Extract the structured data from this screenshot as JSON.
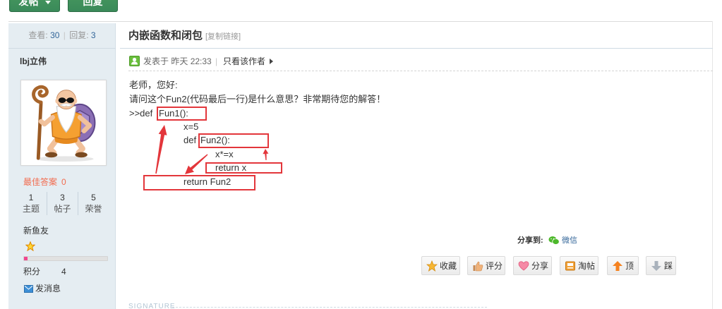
{
  "toolbar": {
    "post_label": "发帖",
    "reply_label": "回复"
  },
  "sidebar": {
    "views_label": "查看:",
    "views": "30",
    "separator": "|",
    "replies_label": "回复:",
    "replies": "3",
    "author": "lbj立伟",
    "best_answer_label": "最佳答案",
    "best_answer": "0",
    "stats": [
      {
        "value": "1",
        "label": "主题"
      },
      {
        "value": "3",
        "label": "帖子"
      },
      {
        "value": "5",
        "label": "荣誉"
      }
    ],
    "group": "新鱼友",
    "level_icon": "star-icon",
    "level_progress_percent": 4,
    "points_label": "积分",
    "points": "4",
    "message_icon": "envelope-icon",
    "message_label": "发消息"
  },
  "post": {
    "title": "内嵌函数和闭包",
    "copy_link": "[复制链接]",
    "author_icon": "user-online-icon",
    "posted_label": "发表于",
    "posted_time": "昨天 22:33",
    "meta_separator": "|",
    "only_author": "只看该作者",
    "body": {
      "greeting": "老师，您好:",
      "question": "请问这个Fun2(代码最后一行)是什么意思？非常期待您的解答！",
      "code": [
        {
          "prefix": ">>def",
          "highlight": "Fun1():"
        },
        {
          "text": "x=5"
        },
        {
          "prefix": "def",
          "highlight": "Fun2():"
        },
        {
          "text": "x*=x"
        },
        {
          "highlight": "return x"
        },
        {
          "highlight": "return Fun2"
        }
      ]
    },
    "share": {
      "label": "分享到:",
      "wechat_icon": "wechat-icon",
      "wechat": "微信"
    },
    "actions": [
      {
        "label": "收藏",
        "icon": "star-icon"
      },
      {
        "label": "评分",
        "icon": "thumbs-up-icon"
      },
      {
        "label": "分享",
        "icon": "heart-icon"
      },
      {
        "label": "淘帖",
        "icon": "tray-icon"
      },
      {
        "label": "顶",
        "icon": "arrow-up-icon"
      },
      {
        "label": "踩",
        "icon": "arrow-down-icon"
      }
    ],
    "signature_label": "SIGNATURE"
  },
  "colors": {
    "accent_green": "#3a8a59",
    "sidebar_bg": "#e5edf2",
    "link_blue": "#336699",
    "best_answer_red": "#f26c4f",
    "annotation_red": "#e3363b",
    "progress_pink": "#f0468f"
  }
}
